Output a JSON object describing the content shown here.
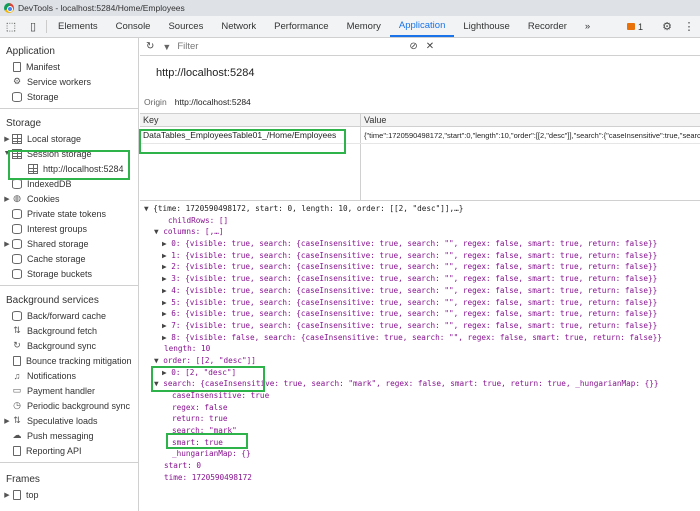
{
  "window": {
    "title": "DevTools - localhost:5284/Home/Employees"
  },
  "tabs": [
    "Elements",
    "Console",
    "Sources",
    "Network",
    "Performance",
    "Memory",
    "Application",
    "Lighthouse",
    "Recorder"
  ],
  "active_tab": "Application",
  "more_tabs": "»",
  "issues_count": "1",
  "sidebar": {
    "application_title": "Application",
    "application_items": [
      "Manifest",
      "Service workers",
      "Storage"
    ],
    "storage_title": "Storage",
    "local_storage": "Local storage",
    "session_storage": "Session storage",
    "session_origin": "http://localhost:5284",
    "storage_items": [
      "IndexedDB",
      "Cookies",
      "Private state tokens",
      "Interest groups",
      "Shared storage",
      "Cache storage",
      "Storage buckets"
    ],
    "background_title": "Background services",
    "background_items": [
      "Back/forward cache",
      "Background fetch",
      "Background sync",
      "Bounce tracking mitigation",
      "Notifications",
      "Payment handler",
      "Periodic background sync",
      "Speculative loads",
      "Push messaging",
      "Reporting API"
    ],
    "frames_title": "Frames",
    "frames_top": "top"
  },
  "main": {
    "filter_placeholder": "Filter",
    "origin_title": "http://localhost:5284",
    "origin_label": "Origin",
    "origin_value": "http://localhost:5284",
    "col_key": "Key",
    "col_value": "Value",
    "row_key": "DataTables_EmployeesTable01_/Home/Employees",
    "row_value": "{\"time\":1720590498172,\"start\":0,\"length\":10,\"order\":[[2,\"desc\"]],\"search\":{\"caseInsensitive\":true,\"search\":\"mark\""
  },
  "json_lines": [
    "{time: 1720590498172, start: 0, length: 10, order: [[2, \"desc\"]],…}",
    "childRows: []",
    "columns: [,…]",
    "0: {visible: true, search: {caseInsensitive: true, search: \"\", regex: false, smart: true, return: false}}",
    "1: {visible: true, search: {caseInsensitive: true, search: \"\", regex: false, smart: true, return: false}}",
    "2: {visible: true, search: {caseInsensitive: true, search: \"\", regex: false, smart: true, return: false}}",
    "3: {visible: true, search: {caseInsensitive: true, search: \"\", regex: false, smart: true, return: false}}",
    "4: {visible: true, search: {caseInsensitive: true, search: \"\", regex: false, smart: true, return: false}}",
    "5: {visible: true, search: {caseInsensitive: true, search: \"\", regex: false, smart: true, return: false}}",
    "6: {visible: true, search: {caseInsensitive: true, search: \"\", regex: false, smart: true, return: false}}",
    "7: {visible: true, search: {caseInsensitive: true, search: \"\", regex: false, smart: true, return: false}}",
    "8: {visible: false, search: {caseInsensitive: true, search: \"\", regex: false, smart: true, return: false}}",
    "length: 10",
    "order: [[2, \"desc\"]]",
    "0: [2, \"desc\"]",
    "search: {caseInsensitive: true, search: \"mark\", regex: false, smart: true, return: true, _hungarianMap: {}}",
    "caseInsensitive: true",
    "regex: false",
    "return: true",
    "search: \"mark\"",
    "smart: true",
    "_hungarianMap: {}",
    "start: 0",
    "time: 1720590498172"
  ]
}
